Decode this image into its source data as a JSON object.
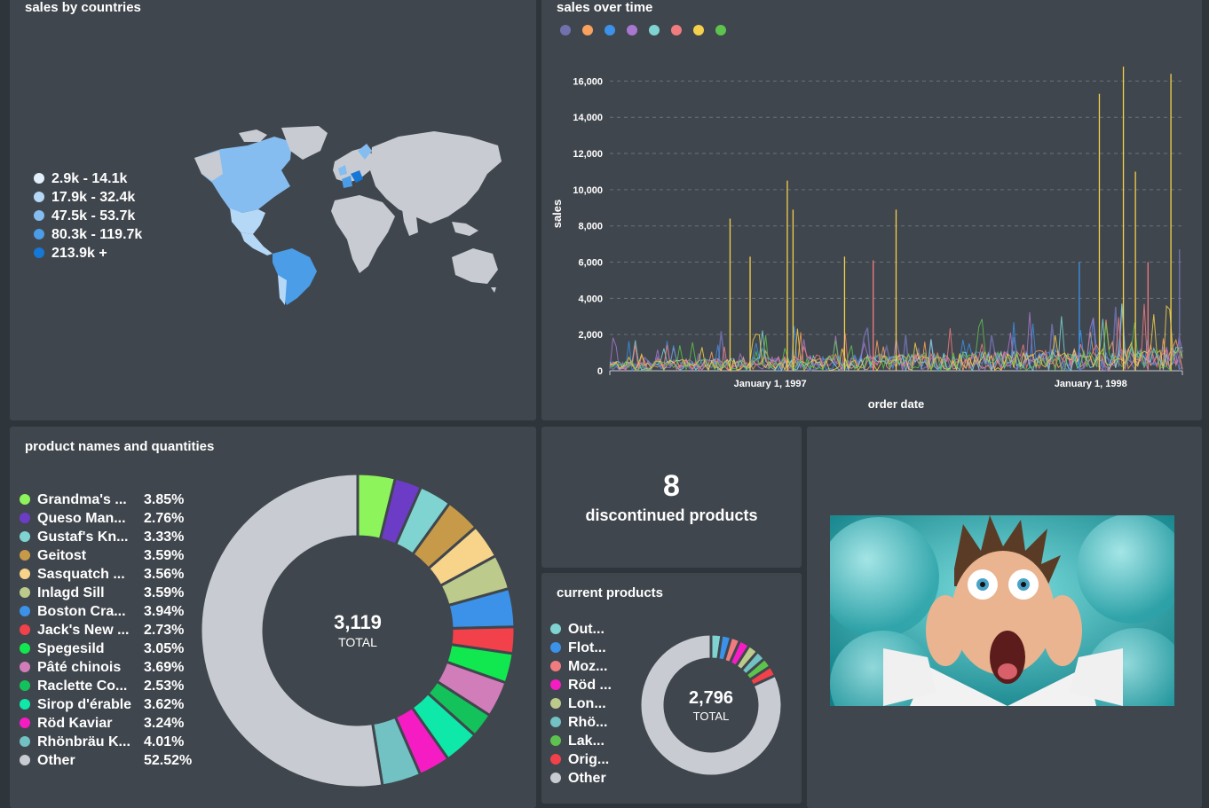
{
  "map_card": {
    "title": "sales by countries",
    "legend": [
      {
        "label": "2.9k - 14.1k",
        "color": "#e3f0fc"
      },
      {
        "label": "17.9k - 32.4k",
        "color": "#b6d8f7"
      },
      {
        "label": "47.5k - 53.7k",
        "color": "#85bdf0"
      },
      {
        "label": "80.3k - 119.7k",
        "color": "#4a9de6"
      },
      {
        "label": "213.9k +",
        "color": "#1577d6"
      }
    ]
  },
  "time_card": {
    "title": "sales over time"
  },
  "products_card": {
    "title": "product names and quantities"
  },
  "discontinued_card": {
    "value": "8",
    "label": "discontinued products"
  },
  "current_card": {
    "title": "current products"
  },
  "image_card": {
    "image_subject": "cartoon man screaming with hands on face"
  },
  "chart_data": [
    {
      "type": "map",
      "title": "sales by countries",
      "legend": [
        "2.9k - 14.1k",
        "17.9k - 32.4k",
        "47.5k - 53.7k",
        "80.3k - 119.7k",
        "213.9k +"
      ]
    },
    {
      "type": "line",
      "title": "sales over time",
      "xlabel": "order date",
      "ylabel": "sales",
      "yticks": [
        "0",
        "2,000",
        "4,000",
        "6,000",
        "8,000",
        "10,000",
        "12,000",
        "14,000",
        "16,000"
      ],
      "ylim": [
        0,
        17000
      ],
      "xticks": [
        "January 1, 1997",
        "January 1, 1998"
      ],
      "grid": true,
      "legend_colors": [
        "#7172ad",
        "#f9a15e",
        "#3b92e8",
        "#a877cf",
        "#7fd4d2",
        "#f17c80",
        "#f5d04a",
        "#5ec24e"
      ],
      "spikes": [
        {
          "date_pos": 0.21,
          "value": 8400,
          "color": "#f5d04a"
        },
        {
          "date_pos": 0.245,
          "value": 6300,
          "color": "#f5d04a"
        },
        {
          "date_pos": 0.31,
          "value": 10500,
          "color": "#f5d04a"
        },
        {
          "date_pos": 0.32,
          "value": 8900,
          "color": "#f5d04a"
        },
        {
          "date_pos": 0.41,
          "value": 6300,
          "color": "#f5d04a"
        },
        {
          "date_pos": 0.46,
          "value": 6100,
          "color": "#f17c80"
        },
        {
          "date_pos": 0.5,
          "value": 8900,
          "color": "#f5d04a"
        },
        {
          "date_pos": 0.82,
          "value": 6000,
          "color": "#3b92e8"
        },
        {
          "date_pos": 0.855,
          "value": 15300,
          "color": "#f5d04a"
        },
        {
          "date_pos": 0.897,
          "value": 16800,
          "color": "#f5d04a"
        },
        {
          "date_pos": 0.918,
          "value": 11000,
          "color": "#f5d04a"
        },
        {
          "date_pos": 0.94,
          "value": 6000,
          "color": "#f17c80"
        },
        {
          "date_pos": 0.98,
          "value": 16400,
          "color": "#f5d04a"
        },
        {
          "date_pos": 0.995,
          "value": 6700,
          "color": "#7172ad"
        }
      ]
    },
    {
      "type": "pie",
      "title": "product names and quantities",
      "total": "3,119",
      "total_label": "TOTAL",
      "slices": [
        {
          "name": "Grandma's ...",
          "pct": "3.85%",
          "value": 3.85,
          "color": "#8ef45b"
        },
        {
          "name": "Queso Man...",
          "pct": "2.76%",
          "value": 2.76,
          "color": "#6d3cc7"
        },
        {
          "name": "Gustaf's Kn...",
          "pct": "3.33%",
          "value": 3.33,
          "color": "#7fd4d2"
        },
        {
          "name": "Geitost",
          "pct": "3.59%",
          "value": 3.59,
          "color": "#c69a48"
        },
        {
          "name": "Sasquatch ...",
          "pct": "3.56%",
          "value": 3.56,
          "color": "#f7d48a"
        },
        {
          "name": "Inlagd Sill",
          "pct": "3.59%",
          "value": 3.59,
          "color": "#bccb8b"
        },
        {
          "name": "Boston Cra...",
          "pct": "3.94%",
          "value": 3.94,
          "color": "#3b92e8"
        },
        {
          "name": "Jack's New ...",
          "pct": "2.73%",
          "value": 2.73,
          "color": "#f2414a"
        },
        {
          "name": "Spegesild",
          "pct": "3.05%",
          "value": 3.05,
          "color": "#11e84f"
        },
        {
          "name": "Pâté chinois",
          "pct": "3.69%",
          "value": 3.69,
          "color": "#d17dba"
        },
        {
          "name": "Raclette Co...",
          "pct": "2.53%",
          "value": 2.53,
          "color": "#14c25c"
        },
        {
          "name": "Sirop d'érable",
          "pct": "3.62%",
          "value": 3.62,
          "color": "#0ee8a8"
        },
        {
          "name": "Röd Kaviar",
          "pct": "3.24%",
          "value": 3.24,
          "color": "#f61cc3"
        },
        {
          "name": "Rhönbräu K...",
          "pct": "4.01%",
          "value": 4.01,
          "color": "#72c1c3"
        },
        {
          "name": "Other",
          "pct": "52.52%",
          "value": 52.52,
          "color": "#c8ccd2"
        }
      ]
    },
    {
      "type": "pie",
      "title": "current products",
      "total": "2,796",
      "total_label": "TOTAL",
      "slices": [
        {
          "name": "Out...",
          "value": 2.4,
          "color": "#7fd4d2"
        },
        {
          "name": "Flot...",
          "value": 2.2,
          "color": "#3b92e8"
        },
        {
          "name": "Moz...",
          "value": 2.1,
          "color": "#f17c80"
        },
        {
          "name": "Röd ...",
          "value": 2.4,
          "color": "#f61cc3"
        },
        {
          "name": "Lon...",
          "value": 2.3,
          "color": "#bccb8b"
        },
        {
          "name": "Rhö...",
          "value": 2.2,
          "color": "#72c1c3"
        },
        {
          "name": "Lak...",
          "value": 2.2,
          "color": "#5ec24e"
        },
        {
          "name": "Orig...",
          "value": 2.3,
          "color": "#f2414a"
        },
        {
          "name": "Other",
          "value": 81.9,
          "color": "#c8ccd2"
        }
      ]
    }
  ]
}
